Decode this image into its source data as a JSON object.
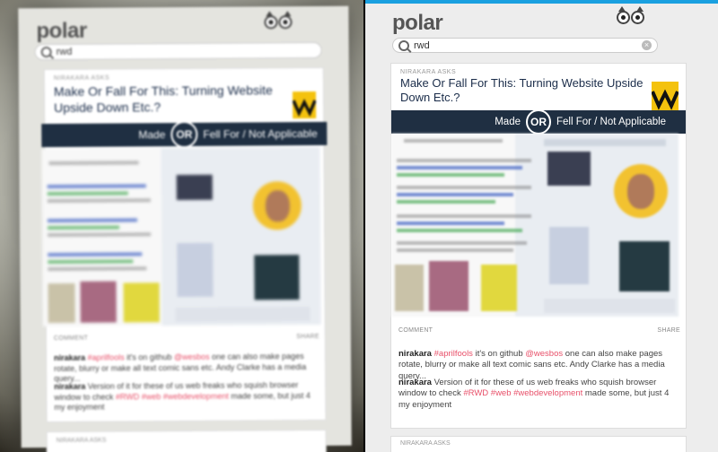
{
  "app": {
    "logo": "polar"
  },
  "search": {
    "value": "rwd",
    "clear_icon": "×"
  },
  "card": {
    "kicker": "NIRAKARA ASKS",
    "title": "Make Or Fall For This: Turning Website Upside Down Etc.?",
    "option_a": "Made",
    "or_label": "OR",
    "option_b": "Fell For / Not Applicable",
    "comment_label": "COMMENT",
    "share_label": "SHARE",
    "comments": [
      {
        "author": "nirakara",
        "parts": [
          {
            "text": "#aprilfools",
            "kind": "tag"
          },
          {
            "text": " it's on github ",
            "kind": "plain"
          },
          {
            "text": "@wesbos",
            "kind": "tag"
          },
          {
            "text": " one can also make pages rotate, blurry or make all text comic sans etc. Andy Clarke has a media query...",
            "kind": "plain"
          }
        ]
      },
      {
        "author": "nirakara",
        "parts": [
          {
            "text": " Version of it for these of us web freaks who squish browser window to check ",
            "kind": "plain"
          },
          {
            "text": "#RWD #web #webdevelopment",
            "kind": "tag"
          },
          {
            "text": " made some, but just 4 my enjoyment",
            "kind": "plain"
          }
        ]
      }
    ]
  },
  "next_card": {
    "kicker": "NIRAKARA ASKS"
  },
  "colors": {
    "accent": "#1aa0e0",
    "bar": "#1f2f42",
    "tag": "#e8516a",
    "badge": "#f4c20d"
  },
  "icons": [
    "owl-logo-icon",
    "search-icon",
    "clear-icon",
    "badge-icon"
  ]
}
